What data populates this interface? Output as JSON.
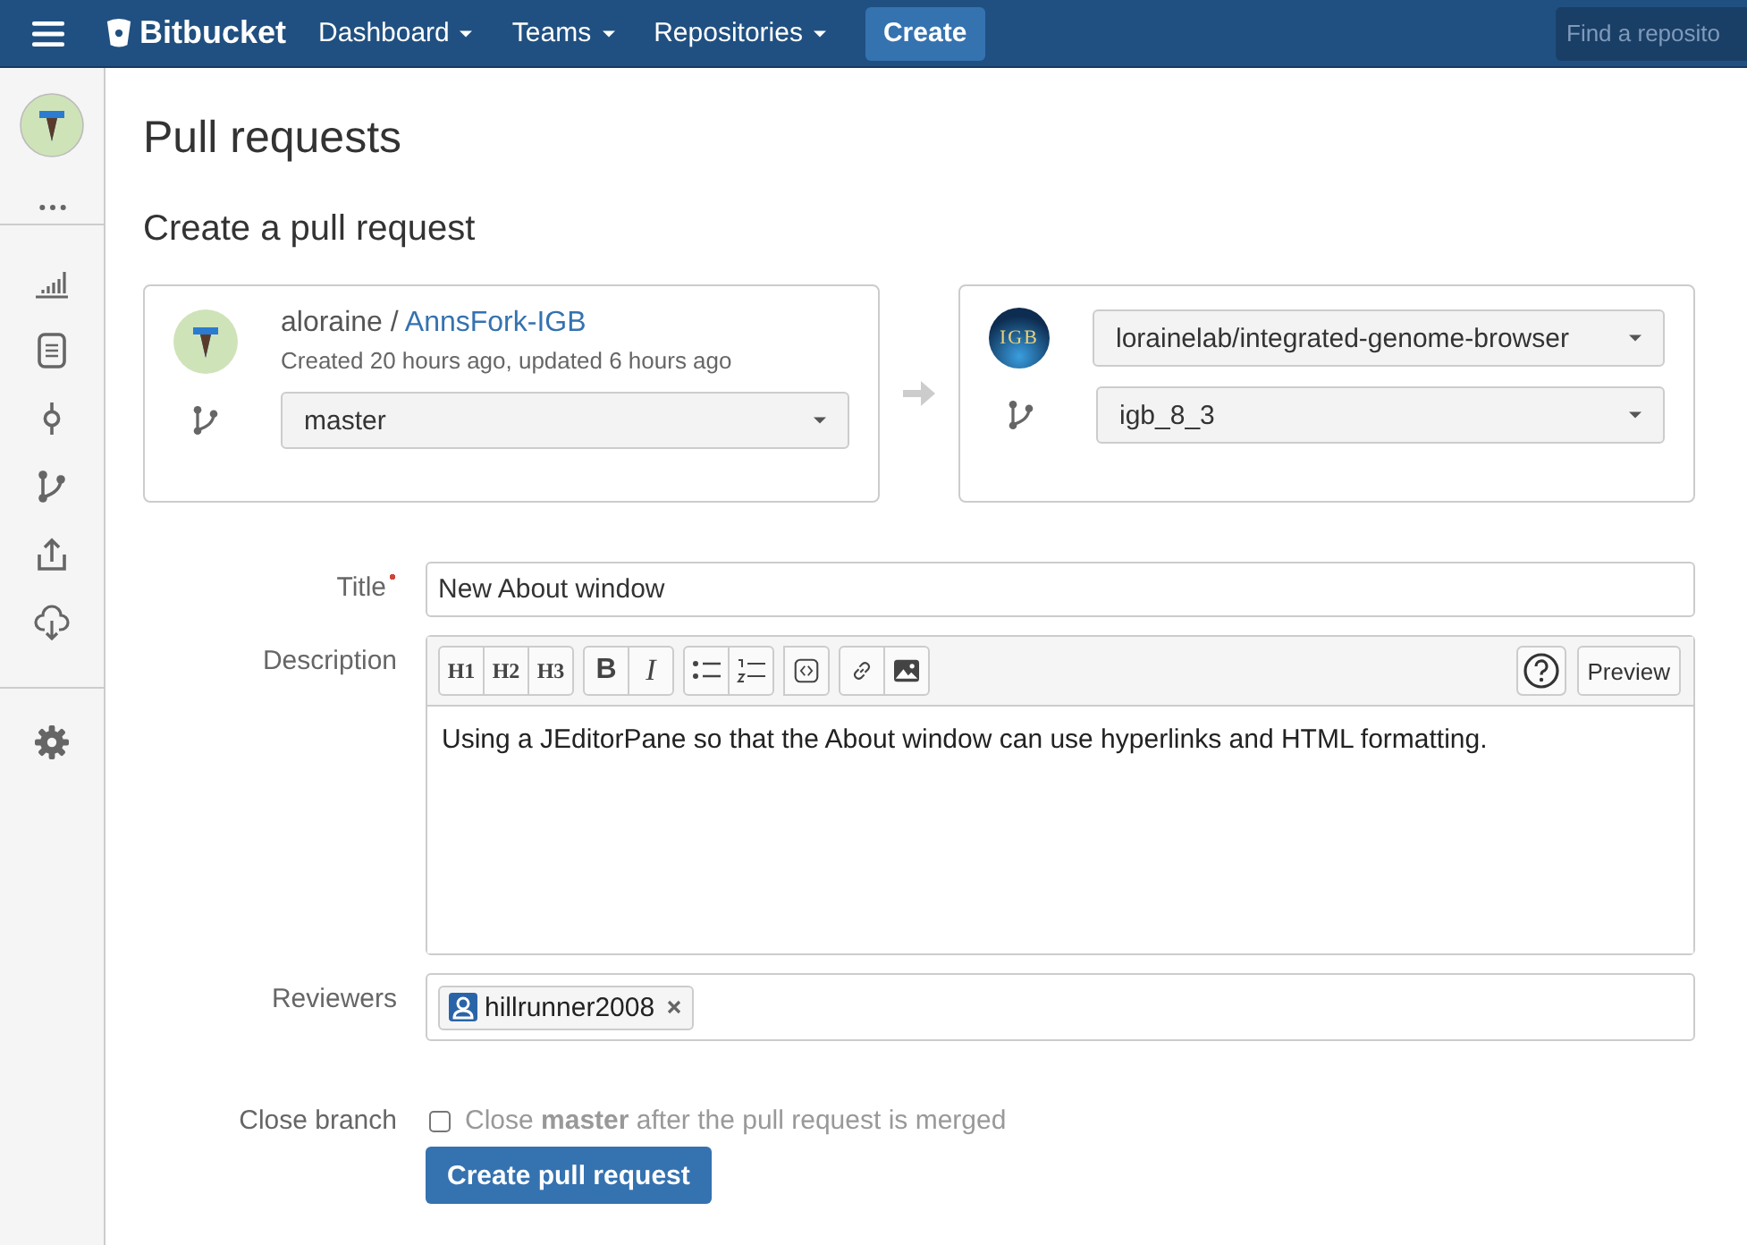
{
  "topbar": {
    "brand": "Bitbucket",
    "nav": [
      {
        "label": "Dashboard",
        "dropdown": true
      },
      {
        "label": "Teams",
        "dropdown": true
      },
      {
        "label": "Repositories",
        "dropdown": true
      }
    ],
    "create": "Create",
    "search": {
      "placeholder": "Find a reposito"
    }
  },
  "sidebar": {
    "items": [
      {
        "kind": "stats"
      },
      {
        "kind": "source"
      },
      {
        "kind": "commits"
      },
      {
        "kind": "branches"
      },
      {
        "kind": "upload"
      },
      {
        "kind": "download"
      }
    ]
  },
  "page_title": "Pull requests",
  "section_title": "Create a pull request",
  "source": {
    "owner": "aloraine",
    "separator": " / ",
    "repo": "AnnsFork-IGB",
    "meta": "Created 20 hours ago, updated 6 hours ago",
    "branch": "master"
  },
  "destination": {
    "logo_text": "IGB",
    "repo": "lorainelab/integrated-genome-browser",
    "branch": "igb_8_3"
  },
  "form": {
    "title_label": "Title",
    "required": true,
    "title_value": "New About window",
    "description_label": "Description",
    "toolbar": [
      [
        {
          "kind": "text",
          "label": "H1"
        },
        {
          "kind": "text",
          "label": "H2"
        },
        {
          "kind": "text",
          "label": "H3"
        }
      ],
      [
        {
          "kind": "bold",
          "label": "B"
        },
        {
          "kind": "italic",
          "label": "I"
        }
      ],
      [
        {
          "kind": "bullets"
        },
        {
          "kind": "numbers"
        }
      ],
      [
        {
          "kind": "code"
        }
      ],
      [
        {
          "kind": "link"
        },
        {
          "kind": "image"
        }
      ]
    ],
    "preview": "Preview",
    "description_value": "Using a JEditorPane so that the About window can use hyperlinks and HTML formatting.",
    "reviewers_label": "Reviewers",
    "reviewers": [
      "hillrunner2008"
    ],
    "close_label": "Close branch",
    "close_checked": false,
    "close_text": "Close **master** after the pull request is merged",
    "submit": "Create pull request"
  }
}
